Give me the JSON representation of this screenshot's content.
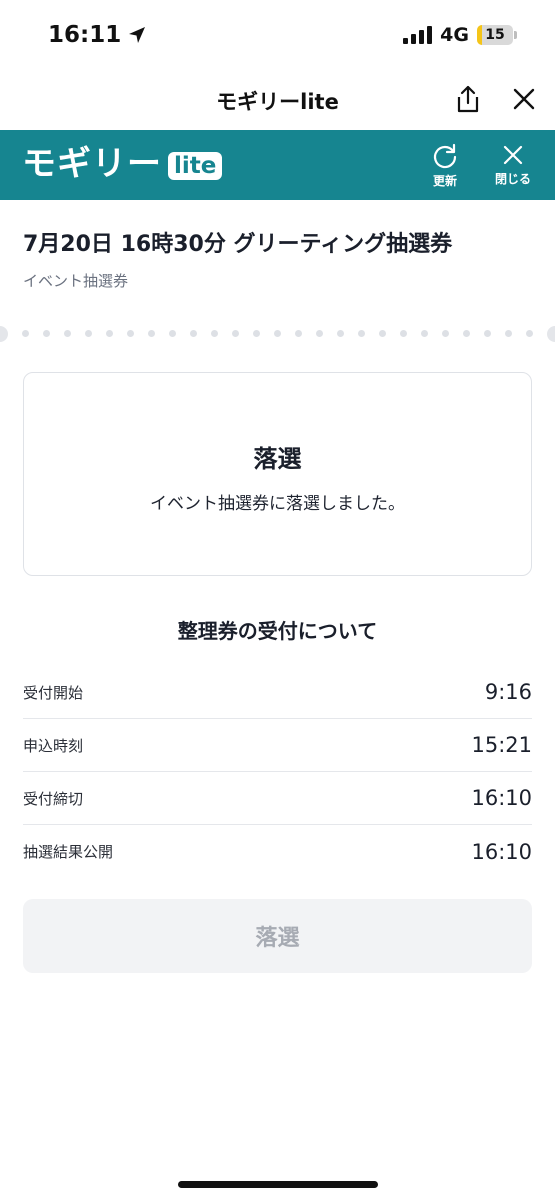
{
  "status_bar": {
    "time": "16:11",
    "network": "4G",
    "battery": "15",
    "battery_level": 0.15
  },
  "nav": {
    "title": "モギリーlite"
  },
  "appbar": {
    "brand": "モギリー",
    "brand_badge": "lite",
    "refresh_label": "更新",
    "close_label": "閉じる",
    "accent_color": "#168590"
  },
  "event": {
    "title": "7月20日 16時30分 グリーティング抽選券",
    "subtitle": "イベント抽選券"
  },
  "result": {
    "title": "落選",
    "message": "イベント抽選券に落選しました。"
  },
  "section": {
    "title": "整理券の受付について",
    "rows": [
      {
        "label": "受付開始",
        "value": "9:16"
      },
      {
        "label": "申込時刻",
        "value": "15:21"
      },
      {
        "label": "受付締切",
        "value": "16:10"
      },
      {
        "label": "抽選結果公開",
        "value": "16:10"
      }
    ]
  },
  "button": {
    "label": "落選"
  }
}
